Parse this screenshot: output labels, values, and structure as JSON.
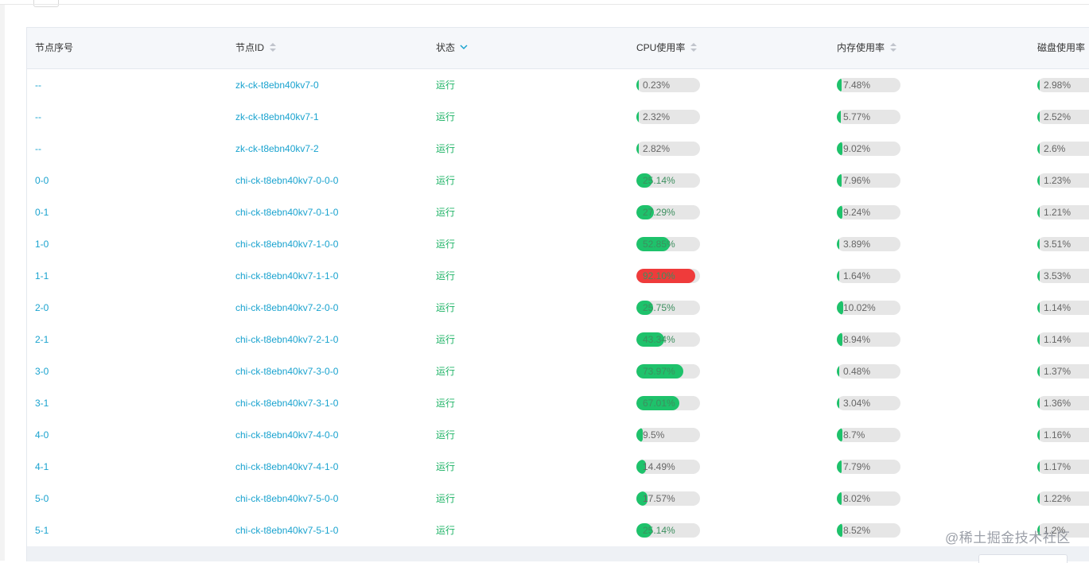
{
  "columns": {
    "index": "节点序号",
    "node_id": "节点ID",
    "status": "状态",
    "cpu": "CPU使用率",
    "mem": "内存使用率",
    "disk": "磁盘使用率"
  },
  "colors": {
    "link": "#1aa3cf",
    "status_ok": "#1eb366",
    "bar_ok": "#1ec26b",
    "bar_alert": "#ef3b3b",
    "bar_track": "#e6e6e6"
  },
  "rows": [
    {
      "index": "--",
      "node_id": "zk-ck-t8ebn40kv7-0",
      "status": "运行",
      "cpu": {
        "label": "0.23%",
        "pct": 0.23
      },
      "mem": {
        "label": "7.48%",
        "pct": 7.48
      },
      "disk": {
        "label": "2.98%",
        "pct": 2.98
      }
    },
    {
      "index": "--",
      "node_id": "zk-ck-t8ebn40kv7-1",
      "status": "运行",
      "cpu": {
        "label": "2.32%",
        "pct": 2.32
      },
      "mem": {
        "label": "5.77%",
        "pct": 5.77
      },
      "disk": {
        "label": "2.52%",
        "pct": 2.52
      }
    },
    {
      "index": "--",
      "node_id": "zk-ck-t8ebn40kv7-2",
      "status": "运行",
      "cpu": {
        "label": "2.82%",
        "pct": 2.82
      },
      "mem": {
        "label": "9.02%",
        "pct": 9.02
      },
      "disk": {
        "label": "2.6%",
        "pct": 2.6
      }
    },
    {
      "index": "0-0",
      "node_id": "chi-ck-t8ebn40kv7-0-0-0",
      "status": "运行",
      "cpu": {
        "label": "25.14%",
        "pct": 25.14
      },
      "mem": {
        "label": "7.96%",
        "pct": 7.96
      },
      "disk": {
        "label": "1.23%",
        "pct": 1.23
      }
    },
    {
      "index": "0-1",
      "node_id": "chi-ck-t8ebn40kv7-0-1-0",
      "status": "运行",
      "cpu": {
        "label": "27.29%",
        "pct": 27.29
      },
      "mem": {
        "label": "9.24%",
        "pct": 9.24
      },
      "disk": {
        "label": "1.21%",
        "pct": 1.21
      }
    },
    {
      "index": "1-0",
      "node_id": "chi-ck-t8ebn40kv7-1-0-0",
      "status": "运行",
      "cpu": {
        "label": "52.85%",
        "pct": 52.85
      },
      "mem": {
        "label": "3.89%",
        "pct": 3.89
      },
      "disk": {
        "label": "3.51%",
        "pct": 3.51
      }
    },
    {
      "index": "1-1",
      "node_id": "chi-ck-t8ebn40kv7-1-1-0",
      "status": "运行",
      "cpu": {
        "label": "92.10%",
        "pct": 92.1
      },
      "mem": {
        "label": "1.64%",
        "pct": 1.64
      },
      "disk": {
        "label": "3.53%",
        "pct": 3.53
      }
    },
    {
      "index": "2-0",
      "node_id": "chi-ck-t8ebn40kv7-2-0-0",
      "status": "运行",
      "cpu": {
        "label": "25.75%",
        "pct": 25.75
      },
      "mem": {
        "label": "10.02%",
        "pct": 10.02
      },
      "disk": {
        "label": "1.14%",
        "pct": 1.14
      }
    },
    {
      "index": "2-1",
      "node_id": "chi-ck-t8ebn40kv7-2-1-0",
      "status": "运行",
      "cpu": {
        "label": "43.34%",
        "pct": 43.34
      },
      "mem": {
        "label": "8.94%",
        "pct": 8.94
      },
      "disk": {
        "label": "1.14%",
        "pct": 1.14
      }
    },
    {
      "index": "3-0",
      "node_id": "chi-ck-t8ebn40kv7-3-0-0",
      "status": "运行",
      "cpu": {
        "label": "73.97%",
        "pct": 73.97
      },
      "mem": {
        "label": "0.48%",
        "pct": 0.48
      },
      "disk": {
        "label": "1.37%",
        "pct": 1.37
      }
    },
    {
      "index": "3-1",
      "node_id": "chi-ck-t8ebn40kv7-3-1-0",
      "status": "运行",
      "cpu": {
        "label": "67.01%",
        "pct": 67.01
      },
      "mem": {
        "label": "3.04%",
        "pct": 3.04
      },
      "disk": {
        "label": "1.36%",
        "pct": 1.36
      }
    },
    {
      "index": "4-0",
      "node_id": "chi-ck-t8ebn40kv7-4-0-0",
      "status": "运行",
      "cpu": {
        "label": "9.5%",
        "pct": 9.5
      },
      "mem": {
        "label": "8.7%",
        "pct": 8.7
      },
      "disk": {
        "label": "1.16%",
        "pct": 1.16
      }
    },
    {
      "index": "4-1",
      "node_id": "chi-ck-t8ebn40kv7-4-1-0",
      "status": "运行",
      "cpu": {
        "label": "14.49%",
        "pct": 14.49
      },
      "mem": {
        "label": "7.79%",
        "pct": 7.79
      },
      "disk": {
        "label": "1.17%",
        "pct": 1.17
      }
    },
    {
      "index": "5-0",
      "node_id": "chi-ck-t8ebn40kv7-5-0-0",
      "status": "运行",
      "cpu": {
        "label": "17.57%",
        "pct": 17.57
      },
      "mem": {
        "label": "8.02%",
        "pct": 8.02
      },
      "disk": {
        "label": "1.22%",
        "pct": 1.22
      }
    },
    {
      "index": "5-1",
      "node_id": "chi-ck-t8ebn40kv7-5-1-0",
      "status": "运行",
      "cpu": {
        "label": "25.14%",
        "pct": 25.14
      },
      "mem": {
        "label": "8.52%",
        "pct": 8.52
      },
      "disk": {
        "label": "1.2%",
        "pct": 1.2
      }
    }
  ],
  "watermark": "@稀土掘金技术社区"
}
